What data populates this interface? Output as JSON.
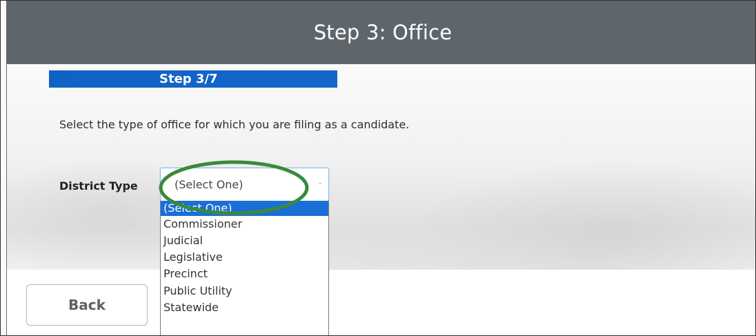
{
  "header": {
    "title": "Step 3: Office"
  },
  "progress": {
    "label": "Step 3/7",
    "fraction": 0.4286
  },
  "form": {
    "instruction": "Select the type of office for which you are filing as a candidate.",
    "district_type": {
      "label": "District Type",
      "selected": "(Select One)",
      "options": [
        "(Select One)",
        "Commissioner",
        "Judicial",
        "Legislative",
        "Precinct",
        "Public Utility",
        "Statewide"
      ],
      "highlighted_index": 0
    }
  },
  "buttons": {
    "back": "Back"
  },
  "icons": {
    "select_arrow": "chevron-down-icon"
  },
  "colors": {
    "header_bg": "#5f666b",
    "progress_bar": "#1566c9",
    "option_highlight": "#1a6fd6",
    "annotation_circle": "#3a8a3a"
  }
}
